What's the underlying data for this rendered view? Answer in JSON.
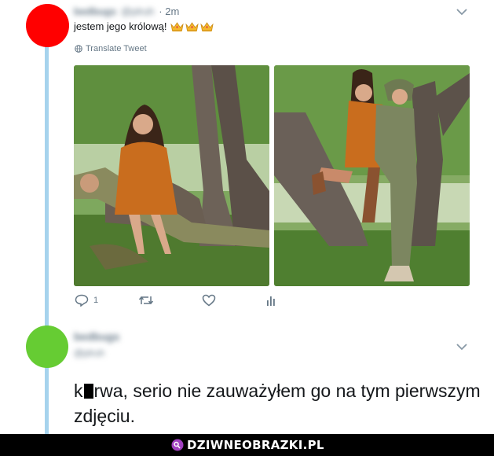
{
  "tweet1": {
    "author_name": "bedbugs",
    "author_handle": "@plruh",
    "time": "· 2m",
    "text": "jestem jego królową!",
    "emoji_icon": "crown-icon",
    "translate_label": "Translate Tweet",
    "photos": [
      {
        "name": "photo-couple-sitting"
      },
      {
        "name": "photo-couple-tree"
      }
    ],
    "actions": {
      "reply_count": "1",
      "retweet_count": "",
      "like_count": "",
      "stats_count": ""
    }
  },
  "tweet2": {
    "author_name": "bedbugs",
    "author_handle": "@plruh",
    "text_prefix": "k",
    "text_rest": "rwa, serio nie zauważyłem go na tym pierwszym zdjęciu."
  },
  "footer": {
    "brand": "DZIWNEOBRAZKI.PL"
  },
  "colors": {
    "thread_line": "#a6d3ed",
    "avatar_1": "#ff0000",
    "avatar_2": "#66cc33",
    "secondary_text": "#657786",
    "footer_bg": "#000000"
  }
}
